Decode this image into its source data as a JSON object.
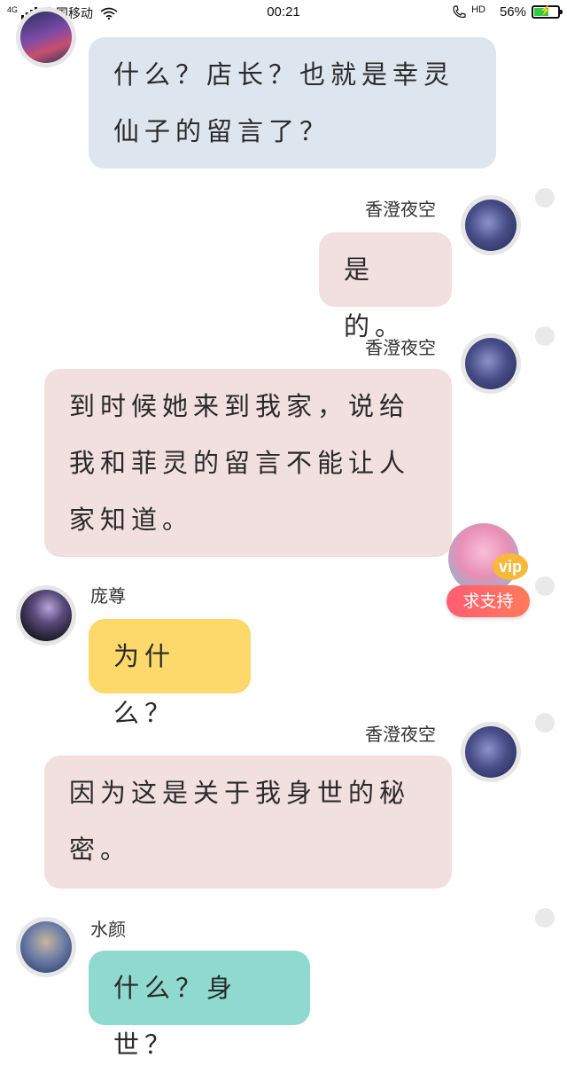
{
  "status_bar": {
    "network": "4G",
    "carrier": "中国移动",
    "time": "00:21",
    "hd": "HD",
    "battery": "56%",
    "battery_level": 0.56,
    "battery_color": "#2ecc40"
  },
  "messages": [
    {
      "sender": "",
      "side": "left",
      "color": "#dde5ee",
      "text": "什么？店长？也就是幸灵仙子的留言了？"
    },
    {
      "sender": "香澄夜空",
      "side": "right",
      "color": "#f2dfe0",
      "text": "是的。"
    },
    {
      "sender": "香澄夜空",
      "side": "right",
      "color": "#f2dfe0",
      "text": "到时候她来到我家，说给我和菲灵的留言不能让人家知道。"
    },
    {
      "sender": "庞尊",
      "side": "left",
      "color": "#fcd96a",
      "text": "为什么？"
    },
    {
      "sender": "香澄夜空",
      "side": "right",
      "color": "#f2dfe0",
      "text": "因为这是关于我身世的秘密。"
    },
    {
      "sender": "水颜",
      "side": "left",
      "color": "#8fd9cf",
      "text": "什么？身世？"
    }
  ],
  "support_widget": {
    "badge": "vip",
    "button_label": "求支持",
    "button_color": "#ff5d73"
  }
}
